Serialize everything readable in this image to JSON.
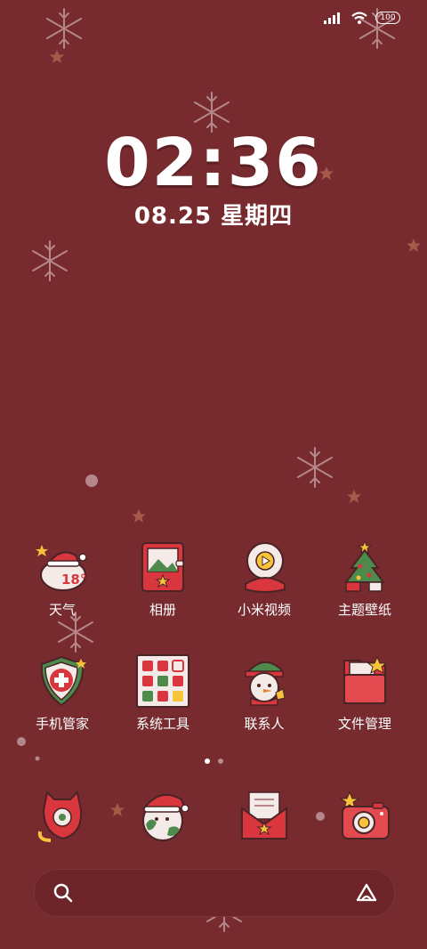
{
  "status_bar": {
    "battery": "100",
    "icons": [
      "signal-icon",
      "wifi-icon",
      "battery-icon"
    ]
  },
  "lock": {
    "time": "02:36",
    "date": "08.25 星期四"
  },
  "apps": [
    {
      "label": "天气",
      "icon": "weather-icon",
      "temp": "18°"
    },
    {
      "label": "相册",
      "icon": "gallery-icon"
    },
    {
      "label": "小米视频",
      "icon": "video-icon"
    },
    {
      "label": "主题壁纸",
      "icon": "theme-icon"
    },
    {
      "label": "手机管家",
      "icon": "security-icon"
    },
    {
      "label": "系统工具",
      "icon": "tools-folder-icon"
    },
    {
      "label": "联系人",
      "icon": "contacts-icon"
    },
    {
      "label": "文件管理",
      "icon": "files-icon"
    }
  ],
  "dock": [
    {
      "icon": "phone-icon"
    },
    {
      "icon": "browser-icon"
    },
    {
      "icon": "messages-icon"
    },
    {
      "icon": "camera-icon"
    }
  ],
  "pager": {
    "count": 2,
    "active": 0
  },
  "search": {
    "icons": [
      "search-icon",
      "assistant-icon"
    ]
  },
  "colors": {
    "background": "#772b2f",
    "accent_red": "#d9363d",
    "star": "#f6c33a"
  }
}
